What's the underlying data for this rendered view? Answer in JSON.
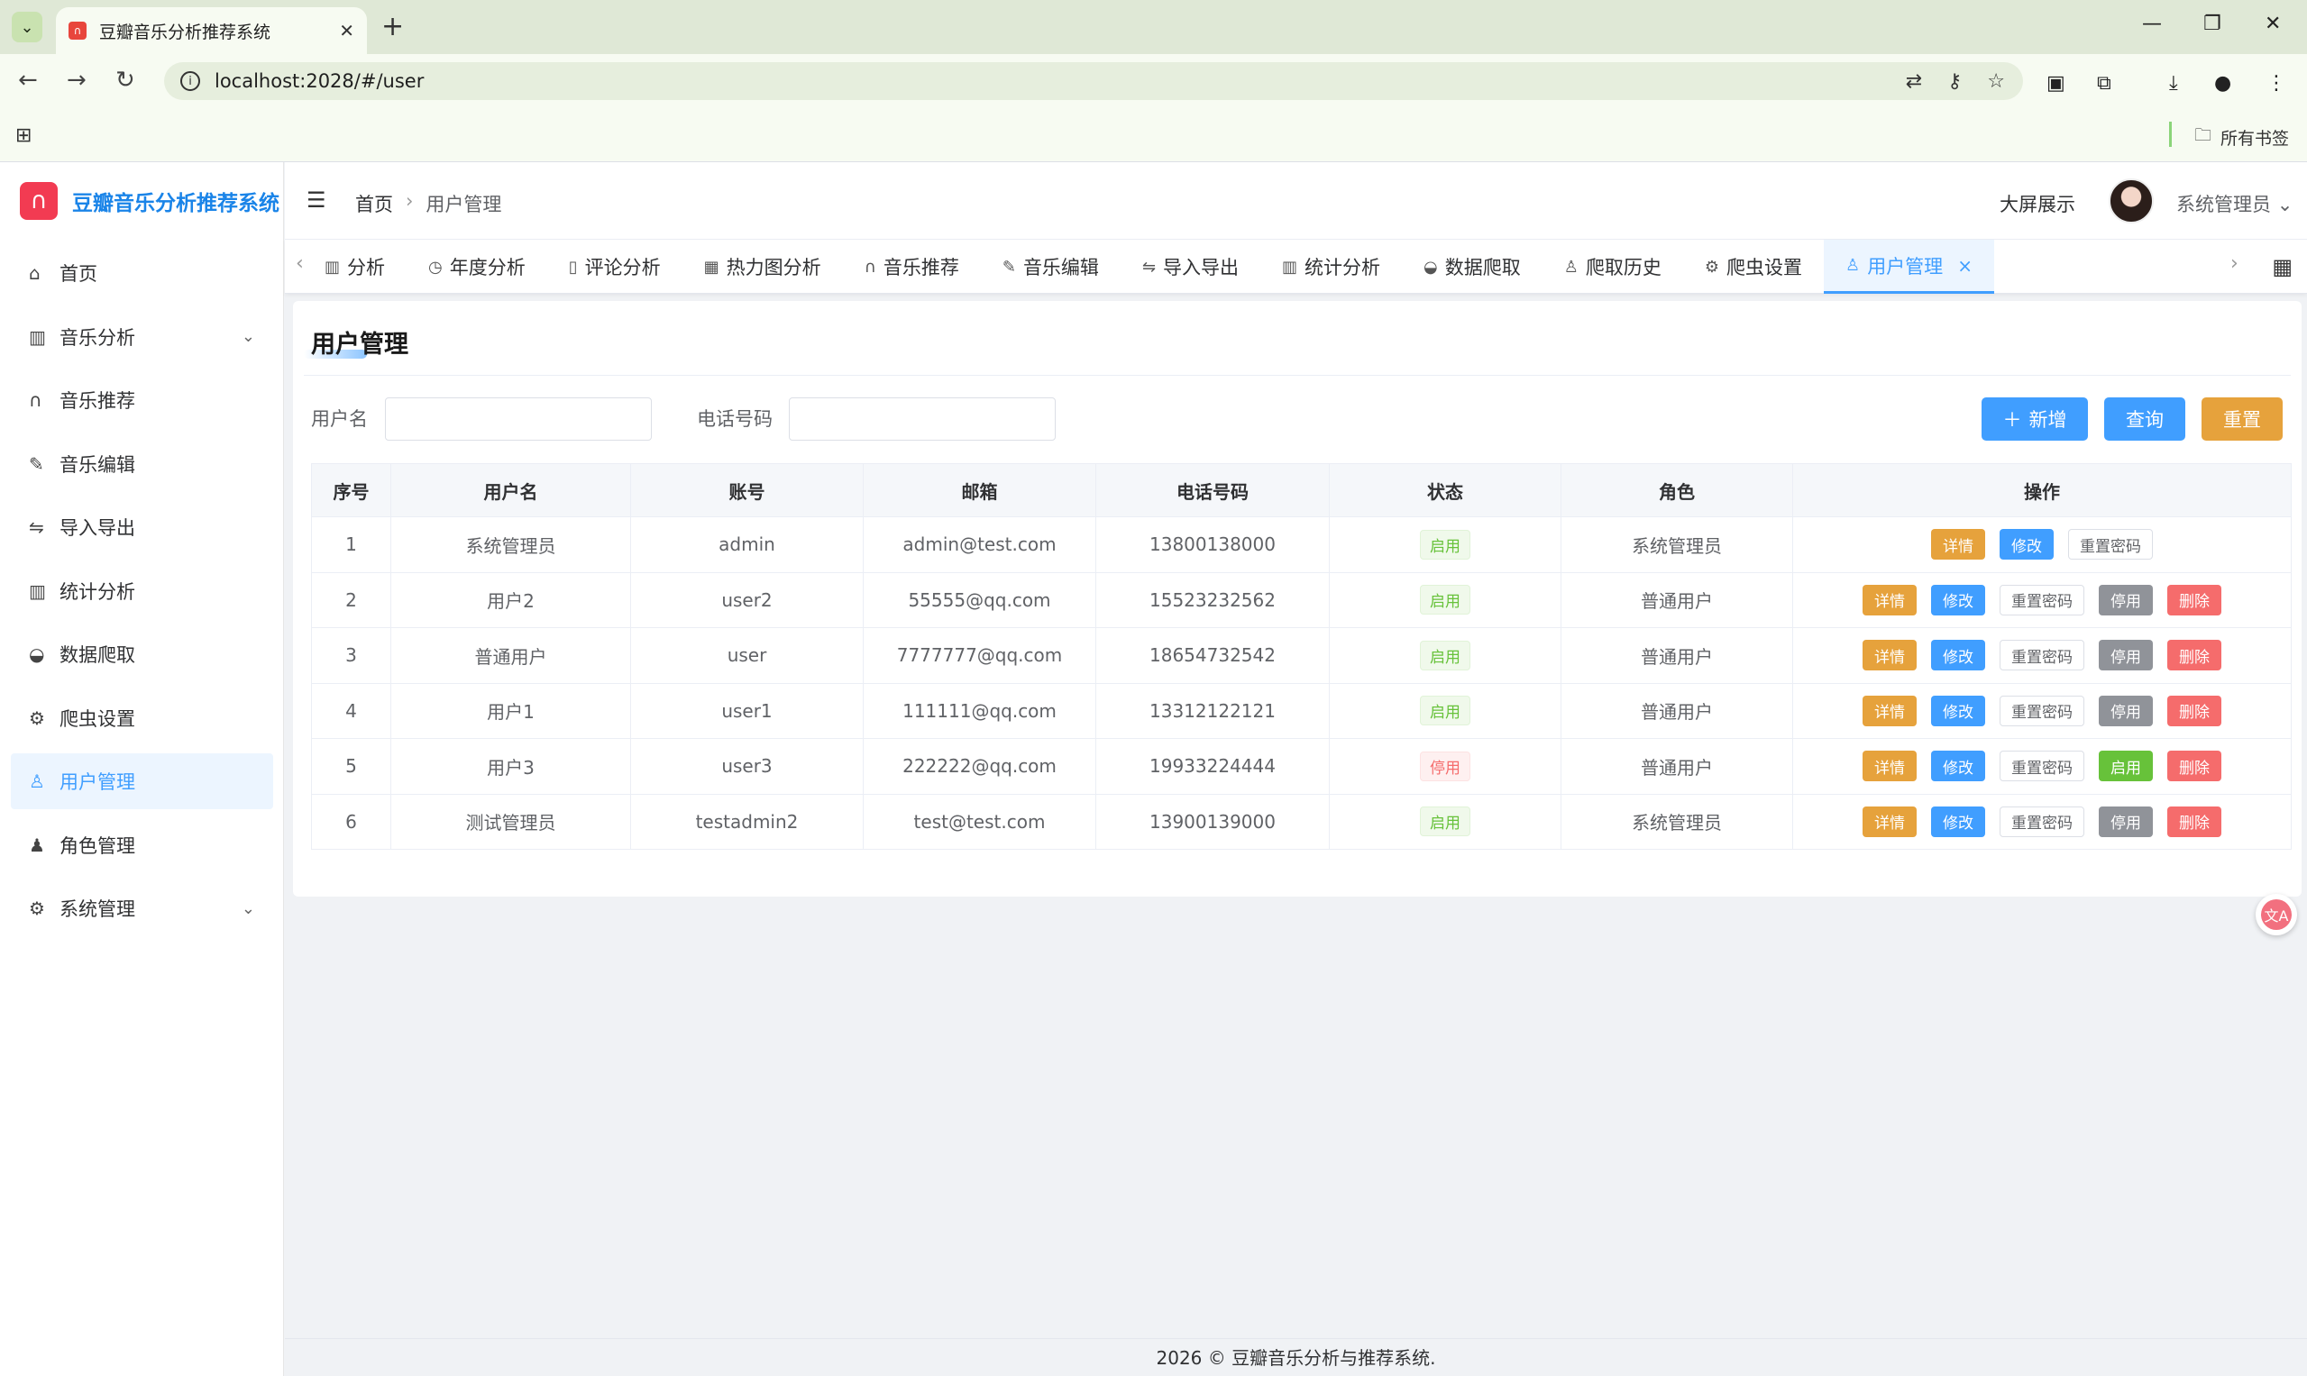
{
  "browser": {
    "tab_title": "豆瓣音乐分析推荐系统",
    "url": "localhost:2028/#/user",
    "bookmarks_label": "所有书签"
  },
  "app": {
    "logo_text": "豆瓣音乐分析推荐系统",
    "accent_color": "#409eff"
  },
  "sidebar": {
    "items": [
      {
        "label": "首页",
        "icon": "home-icon"
      },
      {
        "label": "音乐分析",
        "icon": "chart-icon",
        "expandable": true
      },
      {
        "label": "音乐推荐",
        "icon": "headphones-icon"
      },
      {
        "label": "音乐编辑",
        "icon": "edit-icon"
      },
      {
        "label": "导入导出",
        "icon": "transfer-icon"
      },
      {
        "label": "统计分析",
        "icon": "chart-icon"
      },
      {
        "label": "数据爬取",
        "icon": "bowl-icon"
      },
      {
        "label": "爬虫设置",
        "icon": "gear-icon"
      },
      {
        "label": "用户管理",
        "icon": "user-icon",
        "active": true
      },
      {
        "label": "角色管理",
        "icon": "user-fill-icon"
      },
      {
        "label": "系统管理",
        "icon": "gear-icon",
        "expandable": true
      }
    ]
  },
  "header": {
    "breadcrumb_home": "首页",
    "breadcrumb_current": "用户管理",
    "screen_link": "大屏展示",
    "user_name": "系统管理员"
  },
  "tags": [
    {
      "label": "分析",
      "icon": "chart-icon"
    },
    {
      "label": "年度分析",
      "icon": "clock-icon"
    },
    {
      "label": "评论分析",
      "icon": "book-icon"
    },
    {
      "label": "热力图分析",
      "icon": "grid-icon"
    },
    {
      "label": "音乐推荐",
      "icon": "headphones-icon"
    },
    {
      "label": "音乐编辑",
      "icon": "edit-icon"
    },
    {
      "label": "导入导出",
      "icon": "transfer-icon"
    },
    {
      "label": "统计分析",
      "icon": "chart-icon"
    },
    {
      "label": "数据爬取",
      "icon": "bowl-icon"
    },
    {
      "label": "爬取历史",
      "icon": "user-icon"
    },
    {
      "label": "爬虫设置",
      "icon": "gear-icon"
    },
    {
      "label": "用户管理",
      "icon": "user-icon",
      "active": true
    }
  ],
  "page": {
    "title": "用户管理",
    "search": {
      "username_label": "用户名",
      "username_value": "",
      "phone_label": "电话号码",
      "phone_value": ""
    },
    "buttons": {
      "add": "新增",
      "query": "查询",
      "reset": "重置"
    },
    "table": {
      "columns": [
        "序号",
        "用户名",
        "账号",
        "邮箱",
        "电话号码",
        "状态",
        "角色",
        "操作"
      ],
      "op_labels": {
        "detail": "详情",
        "edit": "修改",
        "reset_pwd": "重置密码",
        "disable": "停用",
        "enable": "启用",
        "delete": "删除"
      },
      "rows": [
        {
          "no": "1",
          "name": "系统管理员",
          "account": "admin",
          "email": "admin@test.com",
          "phone": "13800138000",
          "status": "启用",
          "role": "系统管理员"
        },
        {
          "no": "2",
          "name": "用户2",
          "account": "user2",
          "email": "55555@qq.com",
          "phone": "15523232562",
          "status": "启用",
          "role": "普通用户"
        },
        {
          "no": "3",
          "name": "普通用户",
          "account": "user",
          "email": "7777777@qq.com",
          "phone": "18654732542",
          "status": "启用",
          "role": "普通用户"
        },
        {
          "no": "4",
          "name": "用户1",
          "account": "user1",
          "email": "111111@qq.com",
          "phone": "13312122121",
          "status": "启用",
          "role": "普通用户"
        },
        {
          "no": "5",
          "name": "用户3",
          "account": "user3",
          "email": "222222@qq.com",
          "phone": "19933224444",
          "status": "停用",
          "role": "普通用户"
        },
        {
          "no": "6",
          "name": "测试管理员",
          "account": "testadmin2",
          "email": "test@test.com",
          "phone": "13900139000",
          "status": "启用",
          "role": "系统管理员"
        }
      ]
    }
  },
  "footer": {
    "text": "2026 © 豆瓣音乐分析与推荐系统."
  }
}
